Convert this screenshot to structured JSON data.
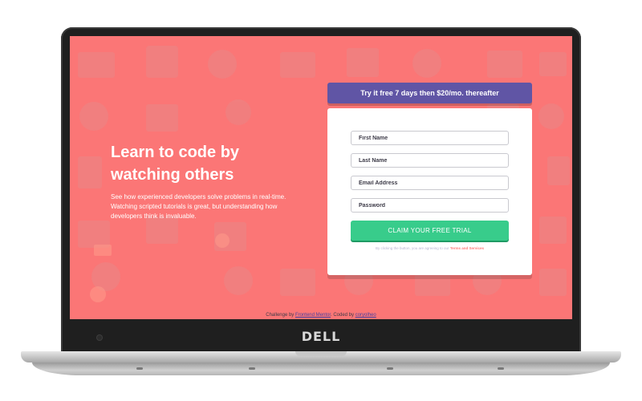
{
  "hero": {
    "title": "Learn to code by watching others",
    "description": "See how experienced developers solve problems in real-time. Watching scripted tutorials is great, but understanding how developers think is invaluable."
  },
  "promo": {
    "text": "Try it free 7 days then $20/mo. thereafter"
  },
  "form": {
    "first_name_placeholder": "First Name",
    "last_name_placeholder": "Last Name",
    "email_placeholder": "Email Address",
    "password_placeholder": "Password",
    "submit_label": "CLAIM YOUR FREE TRIAL",
    "terms_text": "By clicking the button, you are agreeing to our",
    "terms_link": "Terms and Services"
  },
  "footer": {
    "prefix": "Challenge by",
    "challenge_link": "Frontend Mentor",
    "middle": ". Coded by",
    "author_link": "coryolheo"
  },
  "device": {
    "brand": "DELL"
  },
  "colors": {
    "background": "#fb7676",
    "banner": "#6055a5",
    "button": "#38cc8b"
  }
}
